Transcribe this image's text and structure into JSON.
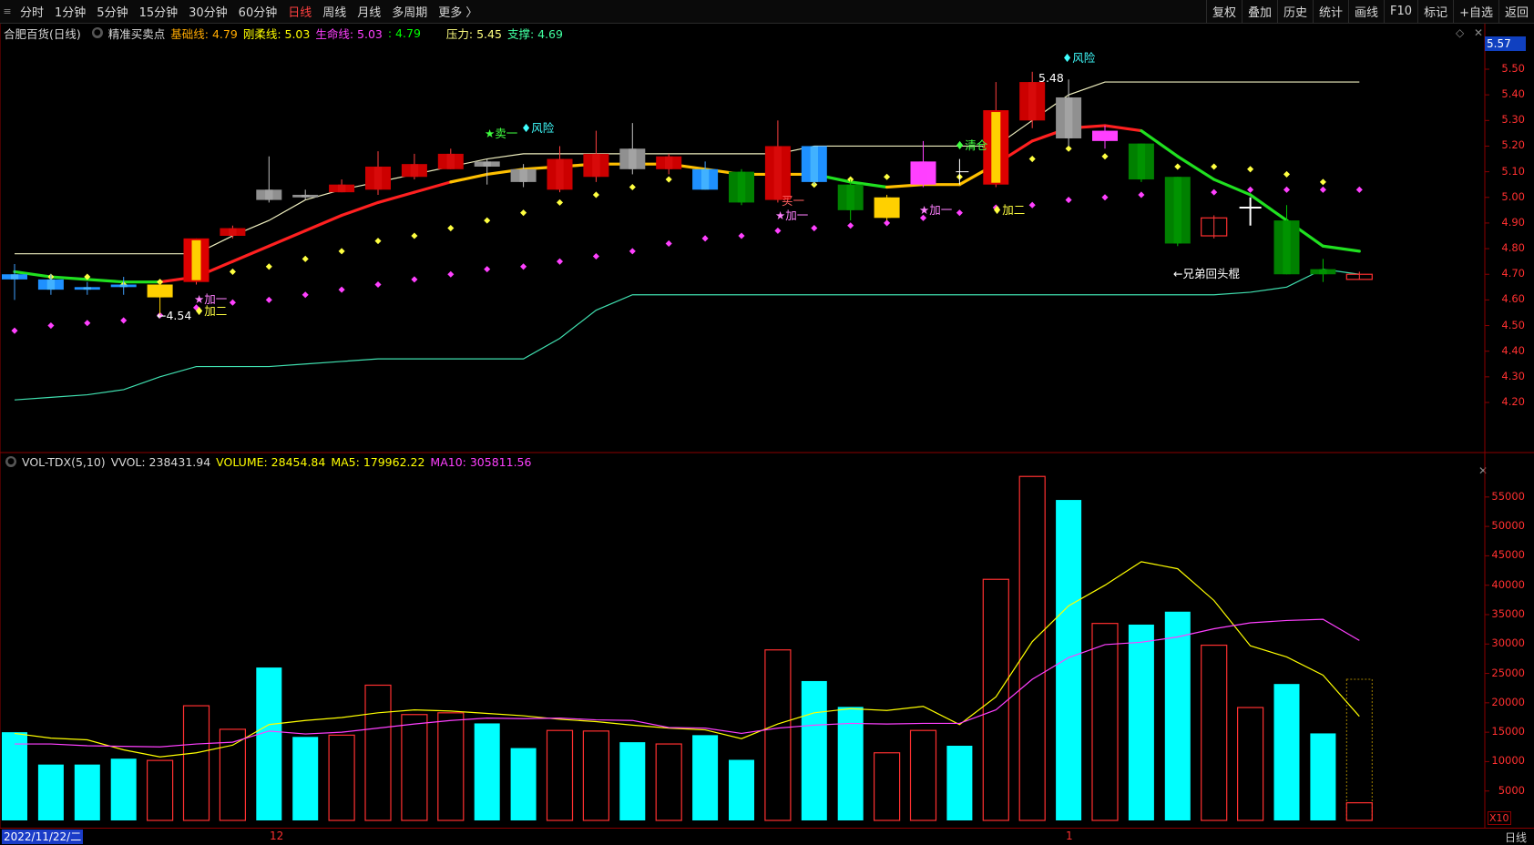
{
  "toolbar": {
    "left_items": [
      "分时",
      "1分钟",
      "5分钟",
      "15分钟",
      "30分钟",
      "60分钟",
      "日线",
      "周线",
      "月线",
      "多周期",
      "更多 〉"
    ],
    "active_index": 6,
    "right_items": [
      "复权",
      "叠加",
      "历史",
      "统计",
      "画线",
      "F10",
      "标记",
      "+自选",
      "返回"
    ]
  },
  "info": {
    "stock": "合肥百货(日线)",
    "indicator": "精准买卖点",
    "base_label": "基础线: 4.79",
    "rigid_label": "刚柔线: 5.03",
    "life_label": "生命线: 5.03",
    "extra_label": ": 4.79",
    "pressure_label": "压力: 5.45",
    "support_label": "支撑: 4.69"
  },
  "vol_info": {
    "name": "VOL-TDX(5,10)",
    "vvol": "VVOL: 238431.94",
    "volume": "VOLUME: 28454.84",
    "ma5": "MA5: 179962.22",
    "ma10": "MA10: 305811.56"
  },
  "price_axis": {
    "current": "5.57",
    "ticks": [
      "5.50",
      "5.40",
      "5.30",
      "5.20",
      "5.10",
      "5.00",
      "4.90",
      "4.80",
      "4.70",
      "4.60",
      "4.50",
      "4.40",
      "4.30",
      "4.20"
    ]
  },
  "vol_axis": {
    "ticks": [
      "55000",
      "50000",
      "45000",
      "40000",
      "35000",
      "30000",
      "25000",
      "20000",
      "15000",
      "10000",
      "5000"
    ],
    "unit": "X10"
  },
  "bottom": {
    "date": "2022/11/22/二",
    "month_marks": [
      "12",
      "1"
    ],
    "period": "日线"
  },
  "colors": {
    "up": "#ff3030",
    "down_cyan": "#00ffff",
    "green": "#00cc00",
    "yellow": "#ffff00",
    "magenta": "#ff40ff",
    "white": "#ffffff"
  },
  "annotations": {
    "low": "←4.54",
    "high": "5.48",
    "sell1": "★卖一",
    "risk": "♦风险",
    "add1": "★加一",
    "add2": "♦加二",
    "clear": "♦清仓",
    "buy1": "买一",
    "pattern": "←兄弟回头棍"
  },
  "chart_data": {
    "type": "candlestick",
    "y_range": [
      4.15,
      5.55
    ],
    "candles": [
      {
        "o": 4.7,
        "h": 4.74,
        "l": 4.6,
        "c": 4.68,
        "style": "blue"
      },
      {
        "o": 4.68,
        "h": 4.7,
        "l": 4.62,
        "c": 4.64,
        "style": "blue"
      },
      {
        "o": 4.65,
        "h": 4.67,
        "l": 4.62,
        "c": 4.64,
        "style": "blue"
      },
      {
        "o": 4.65,
        "h": 4.69,
        "l": 4.62,
        "c": 4.66,
        "style": "blue"
      },
      {
        "o": 4.61,
        "h": 4.67,
        "l": 4.54,
        "c": 4.66,
        "style": "yellow"
      },
      {
        "o": 4.67,
        "h": 4.84,
        "l": 4.66,
        "c": 4.84,
        "style": "redyellow"
      },
      {
        "o": 4.85,
        "h": 4.89,
        "l": 4.84,
        "c": 4.88,
        "style": "red"
      },
      {
        "o": 4.99,
        "h": 5.16,
        "l": 4.98,
        "c": 5.03,
        "style": "gray"
      },
      {
        "o": 5.0,
        "h": 5.03,
        "l": 4.99,
        "c": 5.01,
        "style": "gray"
      },
      {
        "o": 5.02,
        "h": 5.07,
        "l": 5.02,
        "c": 5.05,
        "style": "red"
      },
      {
        "o": 5.03,
        "h": 5.18,
        "l": 5.01,
        "c": 5.12,
        "style": "red"
      },
      {
        "o": 5.08,
        "h": 5.17,
        "l": 5.07,
        "c": 5.13,
        "style": "red"
      },
      {
        "o": 5.11,
        "h": 5.19,
        "l": 5.11,
        "c": 5.17,
        "style": "red"
      },
      {
        "o": 5.12,
        "h": 5.15,
        "l": 5.05,
        "c": 5.14,
        "style": "gray"
      },
      {
        "o": 5.06,
        "h": 5.13,
        "l": 5.04,
        "c": 5.11,
        "style": "gray"
      },
      {
        "o": 5.03,
        "h": 5.2,
        "l": 5.02,
        "c": 5.15,
        "style": "red"
      },
      {
        "o": 5.08,
        "h": 5.26,
        "l": 5.06,
        "c": 5.17,
        "style": "red"
      },
      {
        "o": 5.11,
        "h": 5.29,
        "l": 5.09,
        "c": 5.19,
        "style": "gray"
      },
      {
        "o": 5.11,
        "h": 5.17,
        "l": 5.09,
        "c": 5.16,
        "style": "red"
      },
      {
        "o": 5.11,
        "h": 5.14,
        "l": 5.03,
        "c": 5.03,
        "style": "blue"
      },
      {
        "o": 5.1,
        "h": 5.11,
        "l": 4.97,
        "c": 4.98,
        "style": "green"
      },
      {
        "o": 4.99,
        "h": 5.3,
        "l": 4.98,
        "c": 5.2,
        "style": "red"
      },
      {
        "o": 5.2,
        "h": 5.2,
        "l": 5.05,
        "c": 5.06,
        "style": "blue"
      },
      {
        "o": 5.05,
        "h": 5.07,
        "l": 4.91,
        "c": 4.95,
        "style": "green"
      },
      {
        "o": 4.92,
        "h": 5.01,
        "l": 4.91,
        "c": 5.0,
        "style": "yellow"
      },
      {
        "o": 5.05,
        "h": 5.22,
        "l": 5.04,
        "c": 5.14,
        "style": "magenta"
      },
      {
        "o": 5.1,
        "h": 5.1,
        "l": 5.1,
        "c": 5.1,
        "style": "none"
      },
      {
        "o": 5.05,
        "h": 5.45,
        "l": 5.04,
        "c": 5.34,
        "style": "redyellow"
      },
      {
        "o": 5.3,
        "h": 5.49,
        "l": 5.27,
        "c": 5.45,
        "style": "red"
      },
      {
        "o": 5.39,
        "h": 5.46,
        "l": 5.2,
        "c": 5.23,
        "style": "gray"
      },
      {
        "o": 5.22,
        "h": 5.28,
        "l": 5.19,
        "c": 5.26,
        "style": "magenta"
      },
      {
        "o": 5.21,
        "h": 5.21,
        "l": 5.06,
        "c": 5.07,
        "style": "green"
      },
      {
        "o": 5.08,
        "h": 5.08,
        "l": 4.81,
        "c": 4.82,
        "style": "green"
      },
      {
        "o": 4.85,
        "h": 4.93,
        "l": 4.84,
        "c": 4.92,
        "style": "hollowred"
      },
      {
        "o": 4.96,
        "h": 5.0,
        "l": 4.89,
        "c": 4.96,
        "style": "cross"
      },
      {
        "o": 4.91,
        "h": 4.97,
        "l": 4.7,
        "c": 4.7,
        "style": "green"
      },
      {
        "o": 4.72,
        "h": 4.76,
        "l": 4.67,
        "c": 4.7,
        "style": "green"
      },
      {
        "o": 4.68,
        "h": 4.71,
        "l": 4.68,
        "c": 4.7,
        "style": "hollowred"
      }
    ],
    "lines": {
      "resistance": [
        4.78,
        4.78,
        4.78,
        4.78,
        4.78,
        4.78,
        4.85,
        4.91,
        4.99,
        5.03,
        5.06,
        5.09,
        5.12,
        5.15,
        5.17,
        5.17,
        5.17,
        5.17,
        5.17,
        5.17,
        5.17,
        5.17,
        5.2,
        5.2,
        5.2,
        5.2,
        5.2,
        5.2,
        5.3,
        5.4,
        5.45,
        5.45,
        5.45,
        5.45,
        5.45,
        5.45,
        5.45,
        5.45
      ],
      "support": [
        4.21,
        4.22,
        4.23,
        4.25,
        4.3,
        4.34,
        4.34,
        4.34,
        4.35,
        4.36,
        4.37,
        4.37,
        4.37,
        4.37,
        4.37,
        4.45,
        4.56,
        4.62,
        4.62,
        4.62,
        4.62,
        4.62,
        4.62,
        4.62,
        4.62,
        4.62,
        4.62,
        4.62,
        4.62,
        4.62,
        4.62,
        4.62,
        4.62,
        4.62,
        4.63,
        4.65,
        4.72,
        4.7
      ],
      "ma_short": [
        4.74,
        4.71,
        4.7,
        4.69,
        4.68,
        4.72,
        4.78,
        4.84,
        4.91,
        4.96,
        5.0,
        5.04,
        5.07,
        5.1,
        5.12,
        5.14,
        5.14,
        5.15,
        5.15,
        5.14,
        5.11,
        5.11,
        5.1,
        5.08,
        5.06,
        5.09,
        5.07,
        5.13,
        5.22,
        5.27,
        5.28,
        5.26,
        5.18,
        5.12,
        5.05,
        5.0,
        4.84,
        4.77
      ],
      "life": [
        4.71,
        4.69,
        4.68,
        4.67,
        4.67,
        4.69,
        4.75,
        4.81,
        4.87,
        4.93,
        4.98,
        5.02,
        5.06,
        5.09,
        5.11,
        5.12,
        5.13,
        5.13,
        5.13,
        5.11,
        5.09,
        5.09,
        5.09,
        5.06,
        5.04,
        5.05,
        5.05,
        5.13,
        5.22,
        5.27,
        5.28,
        5.26,
        5.16,
        5.07,
        5.01,
        4.91,
        4.81,
        4.79
      ],
      "upper_dots": [
        null,
        4.69,
        4.69,
        4.66,
        4.67,
        4.69,
        4.71,
        4.73,
        4.76,
        4.79,
        4.83,
        4.85,
        4.88,
        4.91,
        4.94,
        4.98,
        5.01,
        5.04,
        5.07,
        5.06,
        5.05,
        5.04,
        5.05,
        5.07,
        5.08,
        5.09,
        5.08,
        5.13,
        5.15,
        5.19,
        5.16,
        5.12,
        5.12,
        5.12,
        5.11,
        5.09,
        5.06,
        null
      ],
      "lower_dots": [
        4.48,
        4.5,
        4.51,
        4.52,
        4.54,
        4.57,
        4.59,
        4.6,
        4.62,
        4.64,
        4.66,
        4.68,
        4.7,
        4.72,
        4.73,
        4.75,
        4.77,
        4.79,
        4.82,
        4.84,
        4.85,
        4.87,
        4.88,
        4.89,
        4.9,
        4.92,
        4.94,
        4.96,
        4.97,
        4.99,
        5.0,
        5.01,
        5.02,
        5.02,
        5.03,
        5.03,
        5.03,
        5.03
      ]
    },
    "volume": {
      "y_max": 59000,
      "values": [
        15000,
        9500,
        9500,
        10500,
        10200,
        19500,
        15500,
        26000,
        14200,
        14500,
        23000,
        18000,
        18300,
        16500,
        12300,
        15300,
        15200,
        13300,
        13000,
        14500,
        10300,
        29000,
        23700,
        19300,
        11500,
        15300,
        12700,
        41000,
        58500,
        54500,
        33500,
        33300,
        35500,
        29800,
        19200,
        23200,
        14800,
        3000
      ],
      "dir": [
        "d",
        "d",
        "d",
        "d",
        "u",
        "u",
        "u",
        "d",
        "d",
        "u",
        "u",
        "u",
        "u",
        "d",
        "d",
        "u",
        "u",
        "d",
        "u",
        "d",
        "d",
        "u",
        "d",
        "d",
        "u",
        "u",
        "d",
        "u",
        "u",
        "d",
        "u",
        "d",
        "d",
        "u",
        "u",
        "d",
        "d",
        "u"
      ],
      "ma5": [
        14800,
        14000,
        13700,
        12000,
        10800,
        11500,
        12800,
        16300,
        17000,
        17500,
        18300,
        18800,
        18600,
        18200,
        17800,
        17200,
        16800,
        16200,
        15700,
        15400,
        13900,
        16400,
        18300,
        19000,
        18700,
        19400,
        16300,
        21000,
        30400,
        36500,
        40000,
        44000,
        42800,
        37400,
        29700,
        27800,
        24700,
        17700
      ],
      "ma10": [
        13000,
        13000,
        12700,
        12600,
        12500,
        13000,
        13300,
        15200,
        14700,
        15000,
        15700,
        16400,
        17000,
        17400,
        17300,
        17400,
        17100,
        17000,
        15800,
        15700,
        14800,
        15700,
        16200,
        16500,
        16400,
        16500,
        16500,
        18800,
        24000,
        27700,
        29900,
        30300,
        31200,
        32600,
        33600,
        34000,
        34200,
        30600
      ]
    }
  }
}
